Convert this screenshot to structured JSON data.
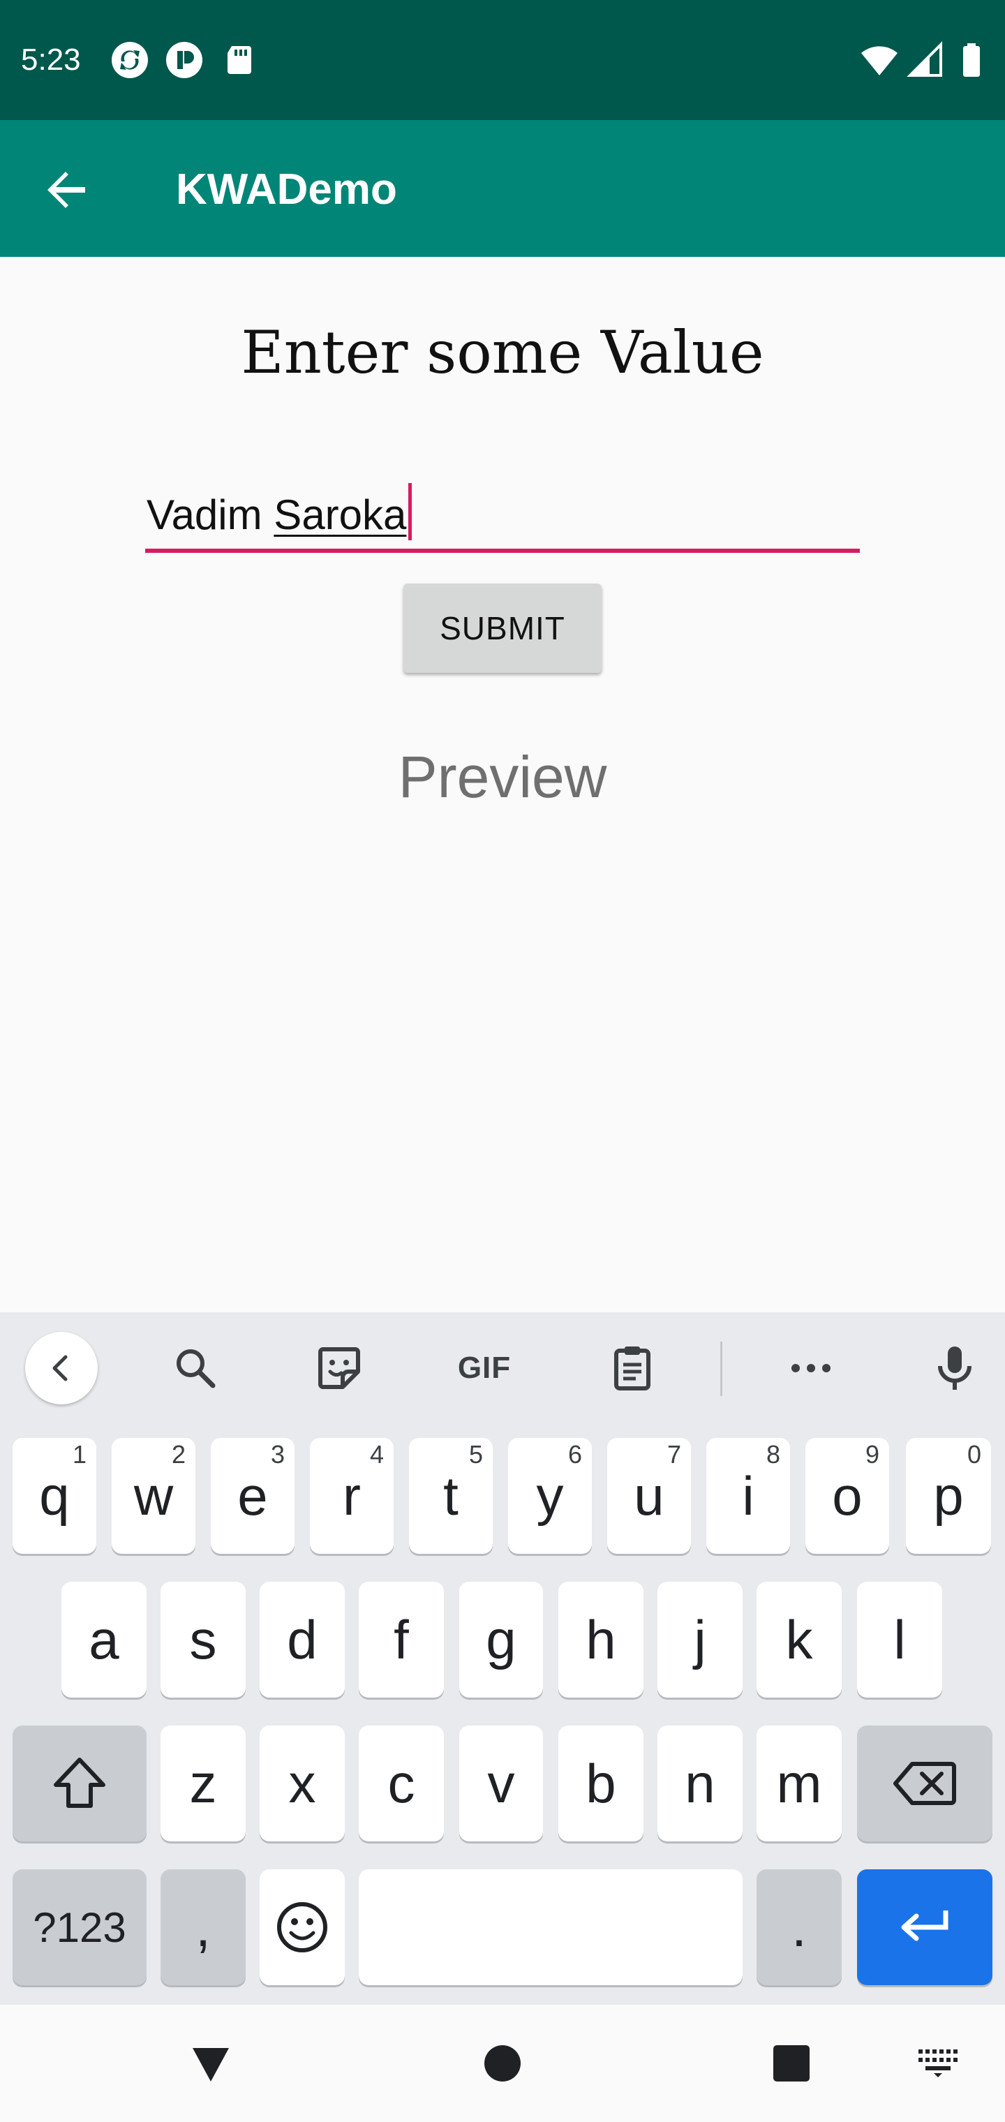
{
  "status_bar": {
    "time": "5:23",
    "left_icons": [
      "sync-icon",
      "app-icon",
      "sd-card-icon"
    ],
    "right_icons": [
      "wifi-icon",
      "signal-icon",
      "battery-icon"
    ]
  },
  "app_bar": {
    "title": "KWADemo",
    "back_icon": "arrow-back-icon",
    "color": "#008577",
    "status_color": "#00574b"
  },
  "main": {
    "heading": "Enter some Value",
    "input": {
      "value_first": "Vadim",
      "value_second": "Saroka",
      "accent_color": "#d81b60"
    },
    "submit_label": "SUBMIT",
    "preview_text": "Preview"
  },
  "keyboard": {
    "toolbar_icons": [
      "chevron-left-icon",
      "search-icon",
      "sticker-icon",
      "gif-icon",
      "clipboard-icon",
      "more-icon",
      "mic-icon"
    ],
    "gif_label": "GIF",
    "row1": [
      {
        "key": "q",
        "hint": "1"
      },
      {
        "key": "w",
        "hint": "2"
      },
      {
        "key": "e",
        "hint": "3"
      },
      {
        "key": "r",
        "hint": "4"
      },
      {
        "key": "t",
        "hint": "5"
      },
      {
        "key": "y",
        "hint": "6"
      },
      {
        "key": "u",
        "hint": "7"
      },
      {
        "key": "i",
        "hint": "8"
      },
      {
        "key": "o",
        "hint": "9"
      },
      {
        "key": "p",
        "hint": "0"
      }
    ],
    "row2": [
      "a",
      "s",
      "d",
      "f",
      "g",
      "h",
      "j",
      "k",
      "l"
    ],
    "row3": [
      "z",
      "x",
      "c",
      "v",
      "b",
      "n",
      "m"
    ],
    "symbols_label": "?123",
    "comma_label": ",",
    "period_label": ".",
    "enter_color": "#1a73e8"
  },
  "nav_bar": {
    "icons": [
      "back-triangle-icon",
      "home-circle-icon",
      "recents-square-icon",
      "keyboard-switch-icon"
    ]
  }
}
